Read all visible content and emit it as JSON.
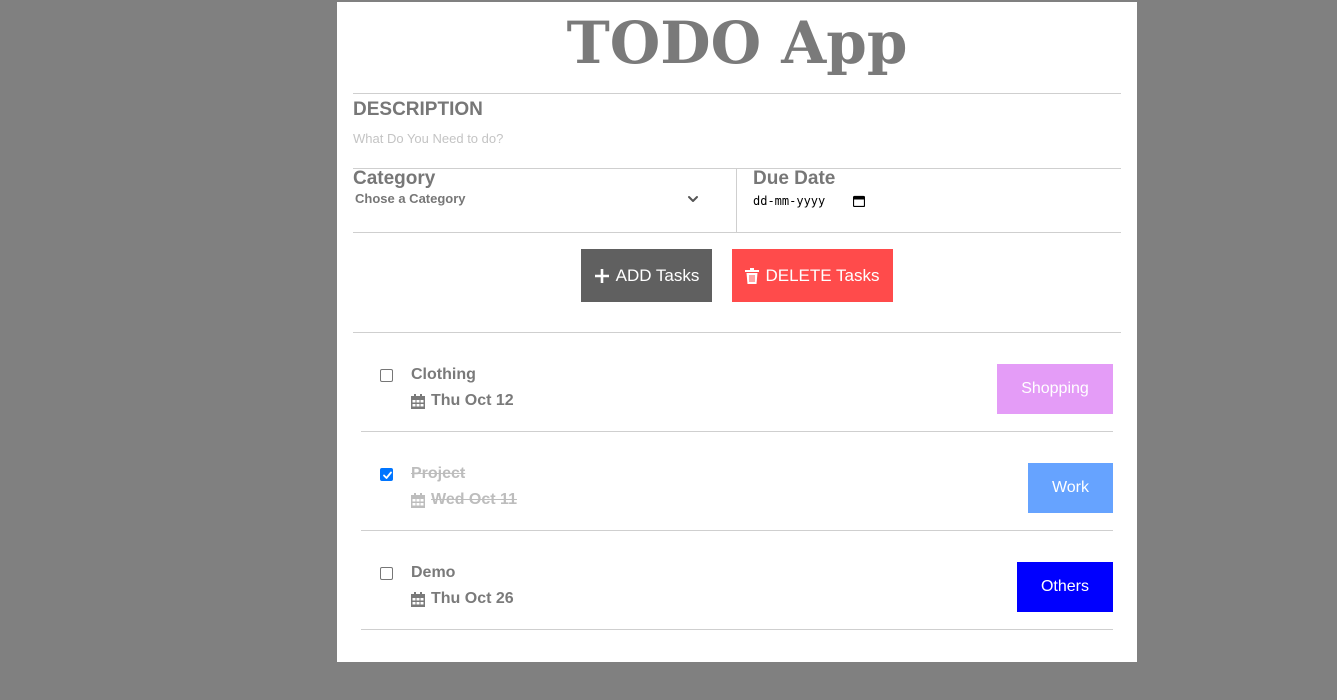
{
  "app": {
    "title": "TODO App"
  },
  "form": {
    "description_label": "DESCRIPTION",
    "description_placeholder": "What Do You Need to do?",
    "description_value": "",
    "category_label": "Category",
    "category_selected": "Chose a Category",
    "due_date_label": "Due Date",
    "due_date_value": "dd-mm-yyyy"
  },
  "actions": {
    "add_label": "ADD Tasks",
    "add_icon": "plus-icon",
    "delete_label": "DELETE Tasks",
    "delete_icon": "trash-icon",
    "add_color": "#606060",
    "delete_color": "#ff4b4b"
  },
  "tasks": [
    {
      "name": "Clothing",
      "date": "Thu Oct 12",
      "category": "Shopping",
      "checked": false,
      "tag_color": "#e49cf7"
    },
    {
      "name": "Project",
      "date": "Wed Oct 11",
      "category": "Work",
      "checked": true,
      "tag_color": "#66a3ff"
    },
    {
      "name": "Demo",
      "date": "Thu Oct 26",
      "category": "Others",
      "checked": false,
      "tag_color": "#0000ff"
    }
  ]
}
